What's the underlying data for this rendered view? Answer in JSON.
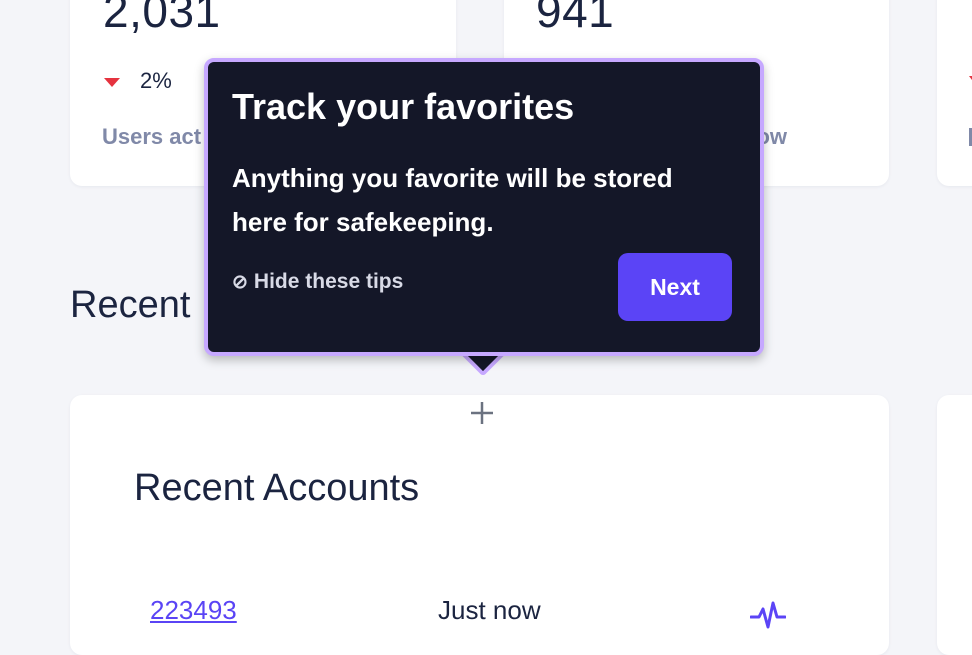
{
  "stats": [
    {
      "value": "2,031",
      "change": "2%",
      "change_direction": "down",
      "label": "Users act"
    },
    {
      "value": "941",
      "label": "ow"
    }
  ],
  "colors": {
    "accent": "#5b44f6",
    "down": "#e5333f",
    "tooltip_bg": "#141728",
    "tooltip_border": "#c6a8ff"
  },
  "section": {
    "title": "Recent"
  },
  "accounts": {
    "title": "Recent Accounts",
    "rows": [
      {
        "id": "223493",
        "time": "Just now",
        "icon": "activity-icon"
      }
    ]
  },
  "tooltip": {
    "title": "Track your favorites",
    "body": "Anything you favorite will be stored here for safekeeping.",
    "hide_label": "Hide these tips",
    "hide_icon": "⊘",
    "next_label": "Next"
  }
}
